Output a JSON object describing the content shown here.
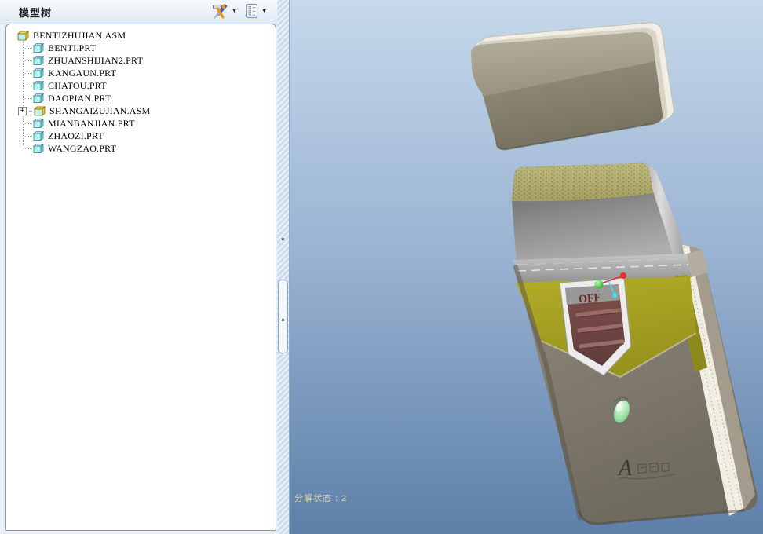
{
  "panel": {
    "title": "模型树",
    "toolbar": {
      "dropdown_arrow": "▼",
      "icons": [
        "tools-icon",
        "tree-display-settings-icon"
      ]
    },
    "tree": {
      "root": {
        "label": "BENTIZHUJIAN.ASM",
        "type": "assembly"
      },
      "items": [
        {
          "label": "BENTI.PRT",
          "type": "part"
        },
        {
          "label": "ZHUANSHIJIAN2.PRT",
          "type": "part"
        },
        {
          "label": "KANGAUN.PRT",
          "type": "part"
        },
        {
          "label": "CHATOU.PRT",
          "type": "part"
        },
        {
          "label": "DAOPIAN.PRT",
          "type": "part"
        },
        {
          "label": "SHANGAIZUJIAN.ASM",
          "type": "assembly",
          "expander": "+"
        },
        {
          "label": "MIANBANJIAN.PRT",
          "type": "part"
        },
        {
          "label": "ZHAOZI.PRT",
          "type": "part"
        },
        {
          "label": "WANGZAO.PRT",
          "type": "part"
        }
      ]
    }
  },
  "viewport": {
    "status_text": "分解状态 : 2",
    "shaver": {
      "switch_label": "OFF",
      "logo_text": "A"
    },
    "colors": {
      "background_top": "#c5d8ea",
      "background_bottom": "#5e80a9",
      "body_gray": "#8b8577",
      "accent_olive": "#a8a41f",
      "switch_maroon": "#7b4a49",
      "button_green": "#9ce2a4",
      "marker_green": "#2ecc2e",
      "marker_red": "#e83030",
      "marker_cyan": "#3fdff0"
    }
  }
}
